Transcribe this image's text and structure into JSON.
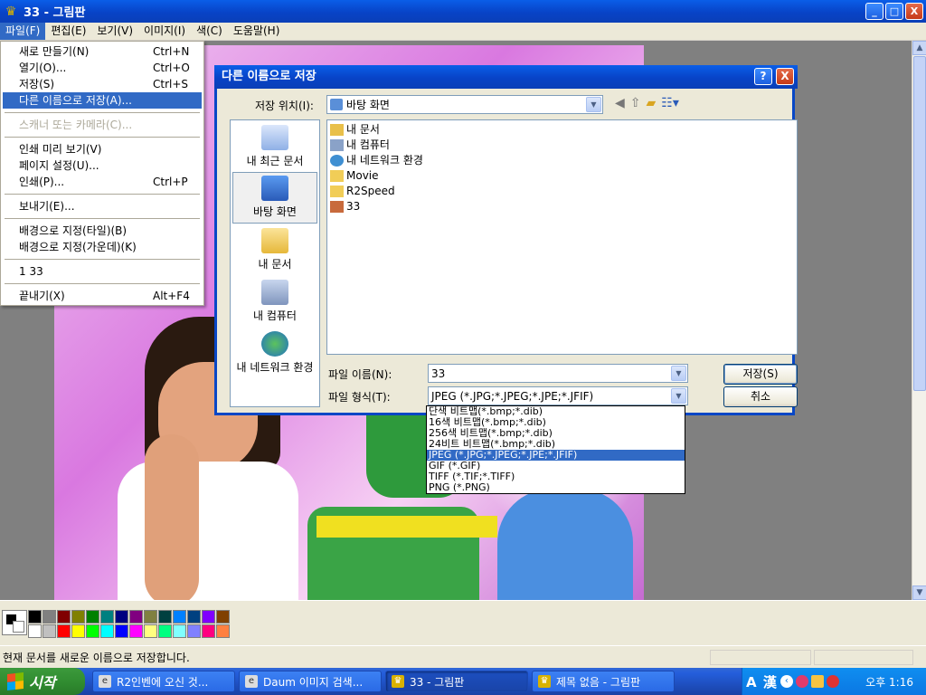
{
  "window": {
    "title": "33 - 그림판",
    "minimize": "_",
    "maximize": "□",
    "close": "X"
  },
  "menubar": [
    {
      "label": "파일(F)"
    },
    {
      "label": "편집(E)"
    },
    {
      "label": "보기(V)"
    },
    {
      "label": "이미지(I)"
    },
    {
      "label": "색(C)"
    },
    {
      "label": "도움말(H)"
    }
  ],
  "file_menu": {
    "items": [
      {
        "label": "새로 만들기(N)",
        "shortcut": "Ctrl+N"
      },
      {
        "label": "열기(O)...",
        "shortcut": "Ctrl+O"
      },
      {
        "label": "저장(S)",
        "shortcut": "Ctrl+S"
      },
      {
        "label": "다른 이름으로 저장(A)...",
        "shortcut": ""
      },
      {
        "label": "스캐너 또는 카메라(C)...",
        "shortcut": ""
      },
      {
        "label": "인쇄 미리 보기(V)",
        "shortcut": ""
      },
      {
        "label": "페이지 설정(U)...",
        "shortcut": ""
      },
      {
        "label": "인쇄(P)...",
        "shortcut": "Ctrl+P"
      },
      {
        "label": "보내기(E)...",
        "shortcut": ""
      },
      {
        "label": "배경으로 지정(타일)(B)",
        "shortcut": ""
      },
      {
        "label": "배경으로 지정(가운데)(K)",
        "shortcut": ""
      },
      {
        "label": "1 33",
        "shortcut": ""
      },
      {
        "label": "끝내기(X)",
        "shortcut": "Alt+F4"
      }
    ]
  },
  "dialog": {
    "title": "다른 이름으로 저장",
    "help": "?",
    "close": "X",
    "save_in_label": "저장 위치(I):",
    "save_in_value": "바탕 화면",
    "places": [
      {
        "label": "내 최근 문서"
      },
      {
        "label": "바탕 화면"
      },
      {
        "label": "내 문서"
      },
      {
        "label": "내 컴퓨터"
      },
      {
        "label": "내 네트워크 환경"
      }
    ],
    "files": [
      {
        "name": "내 문서"
      },
      {
        "name": "내 컴퓨터"
      },
      {
        "name": "내 네트워크 환경"
      },
      {
        "name": "Movie"
      },
      {
        "name": "R2Speed"
      },
      {
        "name": "33"
      }
    ],
    "filename_label": "파일 이름(N):",
    "filename_value": "33",
    "filetype_label": "파일 형식(T):",
    "filetype_value": "JPEG (*.JPG;*.JPEG;*.JPE;*.JFIF)",
    "save_button": "저장(S)",
    "cancel_button": "취소",
    "filetype_options": [
      "단색 비트맵(*.bmp;*.dib)",
      "16색 비트맵(*.bmp;*.dib)",
      "256색 비트맵(*.bmp;*.dib)",
      "24비트 비트맵(*.bmp;*.dib)",
      "JPEG (*.JPG;*.JPEG;*.JPE;*.JFIF)",
      "GIF (*.GIF)",
      "TIFF (*.TIF;*.TIFF)",
      "PNG (*.PNG)"
    ]
  },
  "palette": {
    "colors": [
      "#000000",
      "#808080",
      "#800000",
      "#808000",
      "#008000",
      "#008080",
      "#000080",
      "#800080",
      "#808040",
      "#004040",
      "#0080ff",
      "#004080",
      "#8000ff",
      "#804000",
      "#ffffff",
      "#c0c0c0",
      "#ff0000",
      "#ffff00",
      "#00ff00",
      "#00ffff",
      "#0000ff",
      "#ff00ff",
      "#ffff80",
      "#00ff80",
      "#80ffff",
      "#8080ff",
      "#ff0080",
      "#ff8040"
    ]
  },
  "status": {
    "text": "현재 문서를 새로운 이름으로 저장합니다."
  },
  "taskbar": {
    "start": "시작",
    "buttons": [
      {
        "label": "R2인벤에 오신 것..."
      },
      {
        "label": "Daum 이미지 검색..."
      },
      {
        "label": "33 - 그림판"
      },
      {
        "label": "제목 없음 - 그림판"
      }
    ],
    "ime": "A 漢",
    "clock": "오후 1:16"
  }
}
